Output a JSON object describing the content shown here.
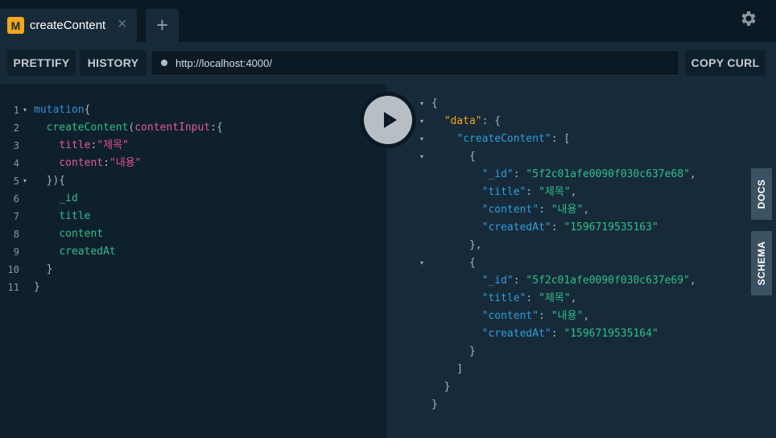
{
  "tab": {
    "badge": "M",
    "title": "createContent",
    "close": "×",
    "add": "+"
  },
  "toolbar": {
    "prettify": "PRETTIFY",
    "history": "HISTORY",
    "url": "http://localhost:4000/",
    "copy_curl": "COPY CURL"
  },
  "side_tabs": {
    "docs": "DOCS",
    "schema": "SCHEMA"
  },
  "icons": {
    "settings": "gear-icon",
    "run": "play-icon"
  },
  "query_lines": [
    {
      "num": "1",
      "fold": "▾",
      "tokens": [
        [
          "kw",
          "mutation"
        ],
        [
          "pn",
          "{"
        ]
      ]
    },
    {
      "num": "2",
      "fold": "",
      "tokens": [
        [
          "pn",
          "  "
        ],
        [
          "fn",
          "createContent"
        ],
        [
          "pn",
          "("
        ],
        [
          "arg",
          "contentInput"
        ],
        [
          "pn",
          ":{"
        ]
      ]
    },
    {
      "num": "3",
      "fold": "",
      "tokens": [
        [
          "pn",
          "    "
        ],
        [
          "arg",
          "title"
        ],
        [
          "pn",
          ":"
        ],
        [
          "str",
          "\"제목\""
        ]
      ]
    },
    {
      "num": "4",
      "fold": "",
      "tokens": [
        [
          "pn",
          "    "
        ],
        [
          "arg",
          "content"
        ],
        [
          "pn",
          ":"
        ],
        [
          "str",
          "\"내용\""
        ]
      ]
    },
    {
      "num": "5",
      "fold": "▾",
      "tokens": [
        [
          "pn",
          "  }){"
        ]
      ]
    },
    {
      "num": "6",
      "fold": "",
      "tokens": [
        [
          "pn",
          "    "
        ],
        [
          "fld",
          "_id"
        ]
      ]
    },
    {
      "num": "7",
      "fold": "",
      "tokens": [
        [
          "pn",
          "    "
        ],
        [
          "fld",
          "title"
        ]
      ]
    },
    {
      "num": "8",
      "fold": "",
      "tokens": [
        [
          "pn",
          "    "
        ],
        [
          "fld",
          "content"
        ]
      ]
    },
    {
      "num": "9",
      "fold": "",
      "tokens": [
        [
          "pn",
          "    "
        ],
        [
          "fld",
          "createdAt"
        ]
      ]
    },
    {
      "num": "10",
      "fold": "",
      "tokens": [
        [
          "pn",
          "  }"
        ]
      ]
    },
    {
      "num": "11",
      "fold": "",
      "tokens": [
        [
          "pn",
          "}"
        ]
      ]
    }
  ],
  "result_lines": [
    {
      "fold": "▾",
      "tokens": [
        [
          "pn",
          "{"
        ]
      ]
    },
    {
      "fold": "▾",
      "tokens": [
        [
          "pn",
          "  "
        ],
        [
          "jkey-data",
          "\"data\""
        ],
        [
          "pn",
          ": {"
        ]
      ]
    },
    {
      "fold": "▾",
      "tokens": [
        [
          "pn",
          "    "
        ],
        [
          "jkey",
          "\"createContent\""
        ],
        [
          "pn",
          ": ["
        ]
      ]
    },
    {
      "fold": "▾",
      "tokens": [
        [
          "pn",
          "      {"
        ]
      ]
    },
    {
      "fold": "",
      "tokens": [
        [
          "pn",
          "        "
        ],
        [
          "jkey",
          "\"_id\""
        ],
        [
          "pn",
          ": "
        ],
        [
          "jstr",
          "\"5f2c01afe0090f030c637e68\""
        ],
        [
          "pn",
          ","
        ]
      ]
    },
    {
      "fold": "",
      "tokens": [
        [
          "pn",
          "        "
        ],
        [
          "jkey",
          "\"title\""
        ],
        [
          "pn",
          ": "
        ],
        [
          "jstr",
          "\"제목\""
        ],
        [
          "pn",
          ","
        ]
      ]
    },
    {
      "fold": "",
      "tokens": [
        [
          "pn",
          "        "
        ],
        [
          "jkey",
          "\"content\""
        ],
        [
          "pn",
          ": "
        ],
        [
          "jstr",
          "\"내용\""
        ],
        [
          "pn",
          ","
        ]
      ]
    },
    {
      "fold": "",
      "tokens": [
        [
          "pn",
          "        "
        ],
        [
          "jkey",
          "\"createdAt\""
        ],
        [
          "pn",
          ": "
        ],
        [
          "jstr",
          "\"1596719535163\""
        ]
      ]
    },
    {
      "fold": "",
      "tokens": [
        [
          "pn",
          "      },"
        ]
      ]
    },
    {
      "fold": "▾",
      "tokens": [
        [
          "pn",
          "      {"
        ]
      ]
    },
    {
      "fold": "",
      "tokens": [
        [
          "pn",
          "        "
        ],
        [
          "jkey",
          "\"_id\""
        ],
        [
          "pn",
          ": "
        ],
        [
          "jstr",
          "\"5f2c01afe0090f030c637e69\""
        ],
        [
          "pn",
          ","
        ]
      ]
    },
    {
      "fold": "",
      "tokens": [
        [
          "pn",
          "        "
        ],
        [
          "jkey",
          "\"title\""
        ],
        [
          "pn",
          ": "
        ],
        [
          "jstr",
          "\"제목\""
        ],
        [
          "pn",
          ","
        ]
      ]
    },
    {
      "fold": "",
      "tokens": [
        [
          "pn",
          "        "
        ],
        [
          "jkey",
          "\"content\""
        ],
        [
          "pn",
          ": "
        ],
        [
          "jstr",
          "\"내용\""
        ],
        [
          "pn",
          ","
        ]
      ]
    },
    {
      "fold": "",
      "tokens": [
        [
          "pn",
          "        "
        ],
        [
          "jkey",
          "\"createdAt\""
        ],
        [
          "pn",
          ": "
        ],
        [
          "jstr",
          "\"1596719535164\""
        ]
      ]
    },
    {
      "fold": "",
      "tokens": [
        [
          "pn",
          "      }"
        ]
      ]
    },
    {
      "fold": "",
      "tokens": [
        [
          "pn",
          "    ]"
        ]
      ]
    },
    {
      "fold": "",
      "tokens": [
        [
          "pn",
          "  }"
        ]
      ]
    },
    {
      "fold": "",
      "tokens": [
        [
          "pn",
          "}"
        ]
      ]
    }
  ]
}
